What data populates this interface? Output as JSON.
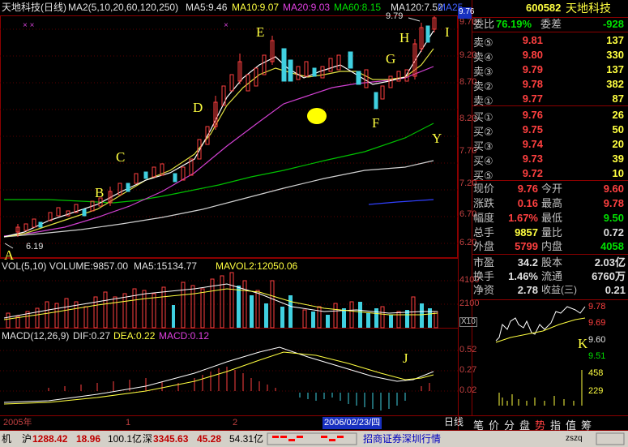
{
  "chart_header": {
    "stock_title": "天地科技(日线)",
    "ma_group": "MA2(5,10,20,60,120,250)",
    "ma5": "MA5:9.46",
    "ma10": "MA10:9.07",
    "ma20": "MA20:9.03",
    "ma60": "MA60:8.15",
    "ma120": "MA120:7.52",
    "ma250": "MA25"
  },
  "price_axis": [
    "9.70",
    "9.20",
    "8.70",
    "8.20",
    "7.70",
    "7.20",
    "6.70",
    "6.20"
  ],
  "current_price_tag": "9.76",
  "annotations": {
    "A": "A",
    "B": "B",
    "C": "C",
    "D": "D",
    "E": "E",
    "F": "F",
    "G": "G",
    "H": "H",
    "I": "I",
    "J": "J",
    "K": "K",
    "Y": "Y",
    "high_mark": "9.79",
    "low_mark": "6.19"
  },
  "volume_header": {
    "title": "VOL(5,10) VOLUME:9857.00",
    "ma5": "MA5:15134.77",
    "mavol2": "MAVOL2:12050.06"
  },
  "volume_axis": [
    "4100",
    "2100",
    "X10"
  ],
  "macd_header": {
    "title": "MACD(12,26,9)",
    "dif": "DIF:0.27",
    "dea": "DEA:0.22",
    "macd": "MACD:0.12"
  },
  "macd_axis": [
    "0.52",
    "0.27",
    "0.02"
  ],
  "time_axis": {
    "year": "2005年",
    "m1": "1",
    "m2": "2",
    "cursor_date": "2006/02/23/四",
    "period_button": "日线"
  },
  "quote": {
    "code": "600582",
    "name": "天地科技",
    "weibi_label": "委比",
    "weibi_value": "76.19%",
    "weicha_label": "委差",
    "weicha_value": "-928",
    "sell": [
      {
        "label": "卖⑤",
        "price": "9.81",
        "vol": "137"
      },
      {
        "label": "卖④",
        "price": "9.80",
        "vol": "330"
      },
      {
        "label": "卖③",
        "price": "9.79",
        "vol": "137"
      },
      {
        "label": "卖②",
        "price": "9.78",
        "vol": "382"
      },
      {
        "label": "卖①",
        "price": "9.77",
        "vol": "87"
      }
    ],
    "buy": [
      {
        "label": "买①",
        "price": "9.76",
        "vol": "26"
      },
      {
        "label": "买②",
        "price": "9.75",
        "vol": "50"
      },
      {
        "label": "买③",
        "price": "9.74",
        "vol": "20"
      },
      {
        "label": "买④",
        "price": "9.73",
        "vol": "39"
      },
      {
        "label": "买⑤",
        "price": "9.72",
        "vol": "10"
      }
    ],
    "stats": [
      {
        "l1": "现价",
        "v1": "9.76",
        "l2": "今开",
        "v2": "9.60"
      },
      {
        "l1": "涨跌",
        "v1": "0.16",
        "l2": "最高",
        "v2": "9.78"
      },
      {
        "l1": "幅度",
        "v1": "1.67%",
        "l2": "最低",
        "v2": "9.50"
      },
      {
        "l1": "总手",
        "v1": "9857",
        "l2": "量比",
        "v2": "0.72"
      },
      {
        "l1": "外盘",
        "v1": "5799",
        "l2": "内盘",
        "v2": "4058"
      }
    ],
    "fundamentals": [
      {
        "l1": "市盈",
        "v1": "34.2",
        "l2": "股本",
        "v2": "2.03亿"
      },
      {
        "l1": "换手",
        "v1": "1.46%",
        "l2": "流通",
        "v2": "6760万"
      },
      {
        "l1": "净资",
        "v1": "2.78",
        "l2": "收益(三)",
        "v2": "0.21"
      }
    ]
  },
  "mini_chart": {
    "labels": [
      "9.78",
      "9.69",
      "9.60",
      "9.51",
      "458",
      "229"
    ]
  },
  "side_tabs": [
    "笔",
    "价",
    "分",
    "盘",
    "势",
    "指",
    "值",
    "筹"
  ],
  "status_bar": {
    "app": "机",
    "sh_label": "沪",
    "sh_index": "1288.42",
    "sh_change": "18.96",
    "sh_amount": "100.1亿",
    "sz_label": "深",
    "sz_index": "3345.63",
    "sz_change": "45.28",
    "sz_amount": "54.31亿",
    "broker": "招商证券深圳行情",
    "ticker": "zszq"
  }
}
